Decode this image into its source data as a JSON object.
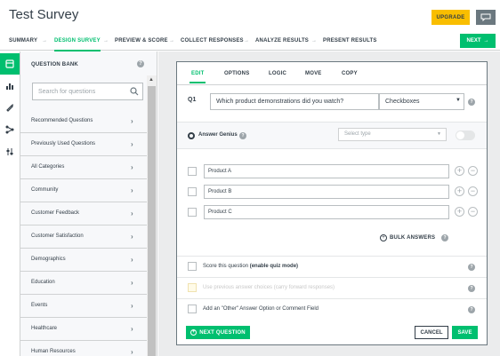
{
  "app": {
    "title": "Test Survey",
    "upgrade_label": "UPGRADE",
    "chat_icon": "chat-bubble-icon"
  },
  "steps": [
    {
      "label": "SUMMARY",
      "active": false
    },
    {
      "label": "DESIGN SURVEY",
      "active": true
    },
    {
      "label": "PREVIEW & SCORE",
      "active": false
    },
    {
      "label": "COLLECT RESPONSES",
      "active": false
    },
    {
      "label": "ANALYZE RESULTS",
      "active": false
    },
    {
      "label": "PRESENT RESULTS",
      "active": false
    }
  ],
  "next_label": "NEXT",
  "rail": [
    {
      "icon": "question-bank-icon",
      "active": true
    },
    {
      "icon": "builder-icon",
      "active": false
    },
    {
      "icon": "themes-icon",
      "active": false
    },
    {
      "icon": "logic-icon",
      "active": false
    },
    {
      "icon": "options-icon",
      "active": false
    }
  ],
  "bank": {
    "title": "QUESTION BANK",
    "help": "?",
    "search_placeholder": "Search for questions",
    "items": [
      "Recommended Questions",
      "Previously Used Questions",
      "All Categories",
      "Community",
      "Customer Feedback",
      "Customer Satisfaction",
      "Demographics",
      "Education",
      "Events",
      "Healthcare",
      "Human Resources"
    ]
  },
  "editor": {
    "tabs": [
      "EDIT",
      "OPTIONS",
      "LOGIC",
      "MOVE",
      "COPY"
    ],
    "active_tab": "EDIT",
    "question_number": "Q1",
    "question_text": "Which product demonstrations did you watch?",
    "question_type": "Checkboxes",
    "answer_genius_label": "Answer Genius",
    "answer_genius_placeholder": "Select type",
    "answers": [
      "Product A",
      "Product B",
      "Product C"
    ],
    "bulk_answers_label": "BULK ANSWERS",
    "options": {
      "score_prefix": "Score this question ",
      "score_bold": "(enable quiz mode)",
      "carry_forward": "Use previous answer choices (carry forward responses)",
      "other_option": "Add an \"Other\" Answer Option or Comment Field"
    },
    "next_question_label": "NEXT QUESTION",
    "cancel_label": "CANCEL",
    "save_label": "SAVE"
  },
  "colors": {
    "accent": "#00bf6f",
    "upgrade": "#f9be00",
    "text": "#333e48"
  }
}
